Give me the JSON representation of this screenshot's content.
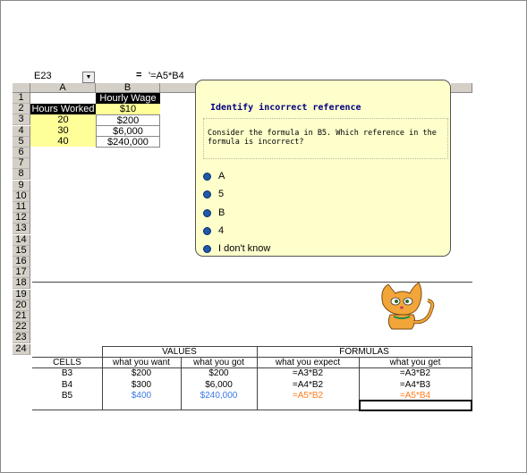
{
  "formula_bar": {
    "cell_ref": "E23",
    "equals": "=",
    "formula": "'=A5*B4"
  },
  "columns": [
    "A",
    "B"
  ],
  "rows": [
    "1",
    "2",
    "3",
    "4",
    "5",
    "6",
    "7",
    "8",
    "9",
    "10",
    "11",
    "12",
    "13",
    "14",
    "15",
    "16",
    "17",
    "18",
    "19",
    "20",
    "21",
    "22",
    "23",
    "24"
  ],
  "sheet": {
    "b1": "Hourly Wage",
    "a2": "Hours Worked",
    "b2": "$10",
    "a3": "20",
    "b3": "$200",
    "a4": "30",
    "b4": "$6,000",
    "a5": "40",
    "b5": "$240,000"
  },
  "balloon": {
    "title": "Identify incorrect reference",
    "question": "Consider the formula in B5. Which reference in the formula is incorrect?",
    "options": [
      "A",
      "5",
      "B",
      "4",
      "I don't know"
    ]
  },
  "assistant_icon": "cat-assistant-icon",
  "table": {
    "group_values": "VALUES",
    "group_formulas": "FORMULAS",
    "headers": [
      "CELLS",
      "what you want",
      "what you got",
      "what you expect",
      "what you get"
    ],
    "rows": [
      [
        "B3",
        "$200",
        "$200",
        "=A3*B2",
        "=A3*B2"
      ],
      [
        "B4",
        "$300",
        "$6,000",
        "=A4*B2",
        "=A4*B3"
      ],
      [
        "B5",
        "$400",
        "$240,000",
        "=A5*B2",
        "=A5*B4"
      ]
    ]
  },
  "colors": {
    "highlight": "#ffff99",
    "blue_values": "#3b78e7",
    "orange_formulas": "#ff7a1a",
    "balloon": "#ffffcc"
  }
}
